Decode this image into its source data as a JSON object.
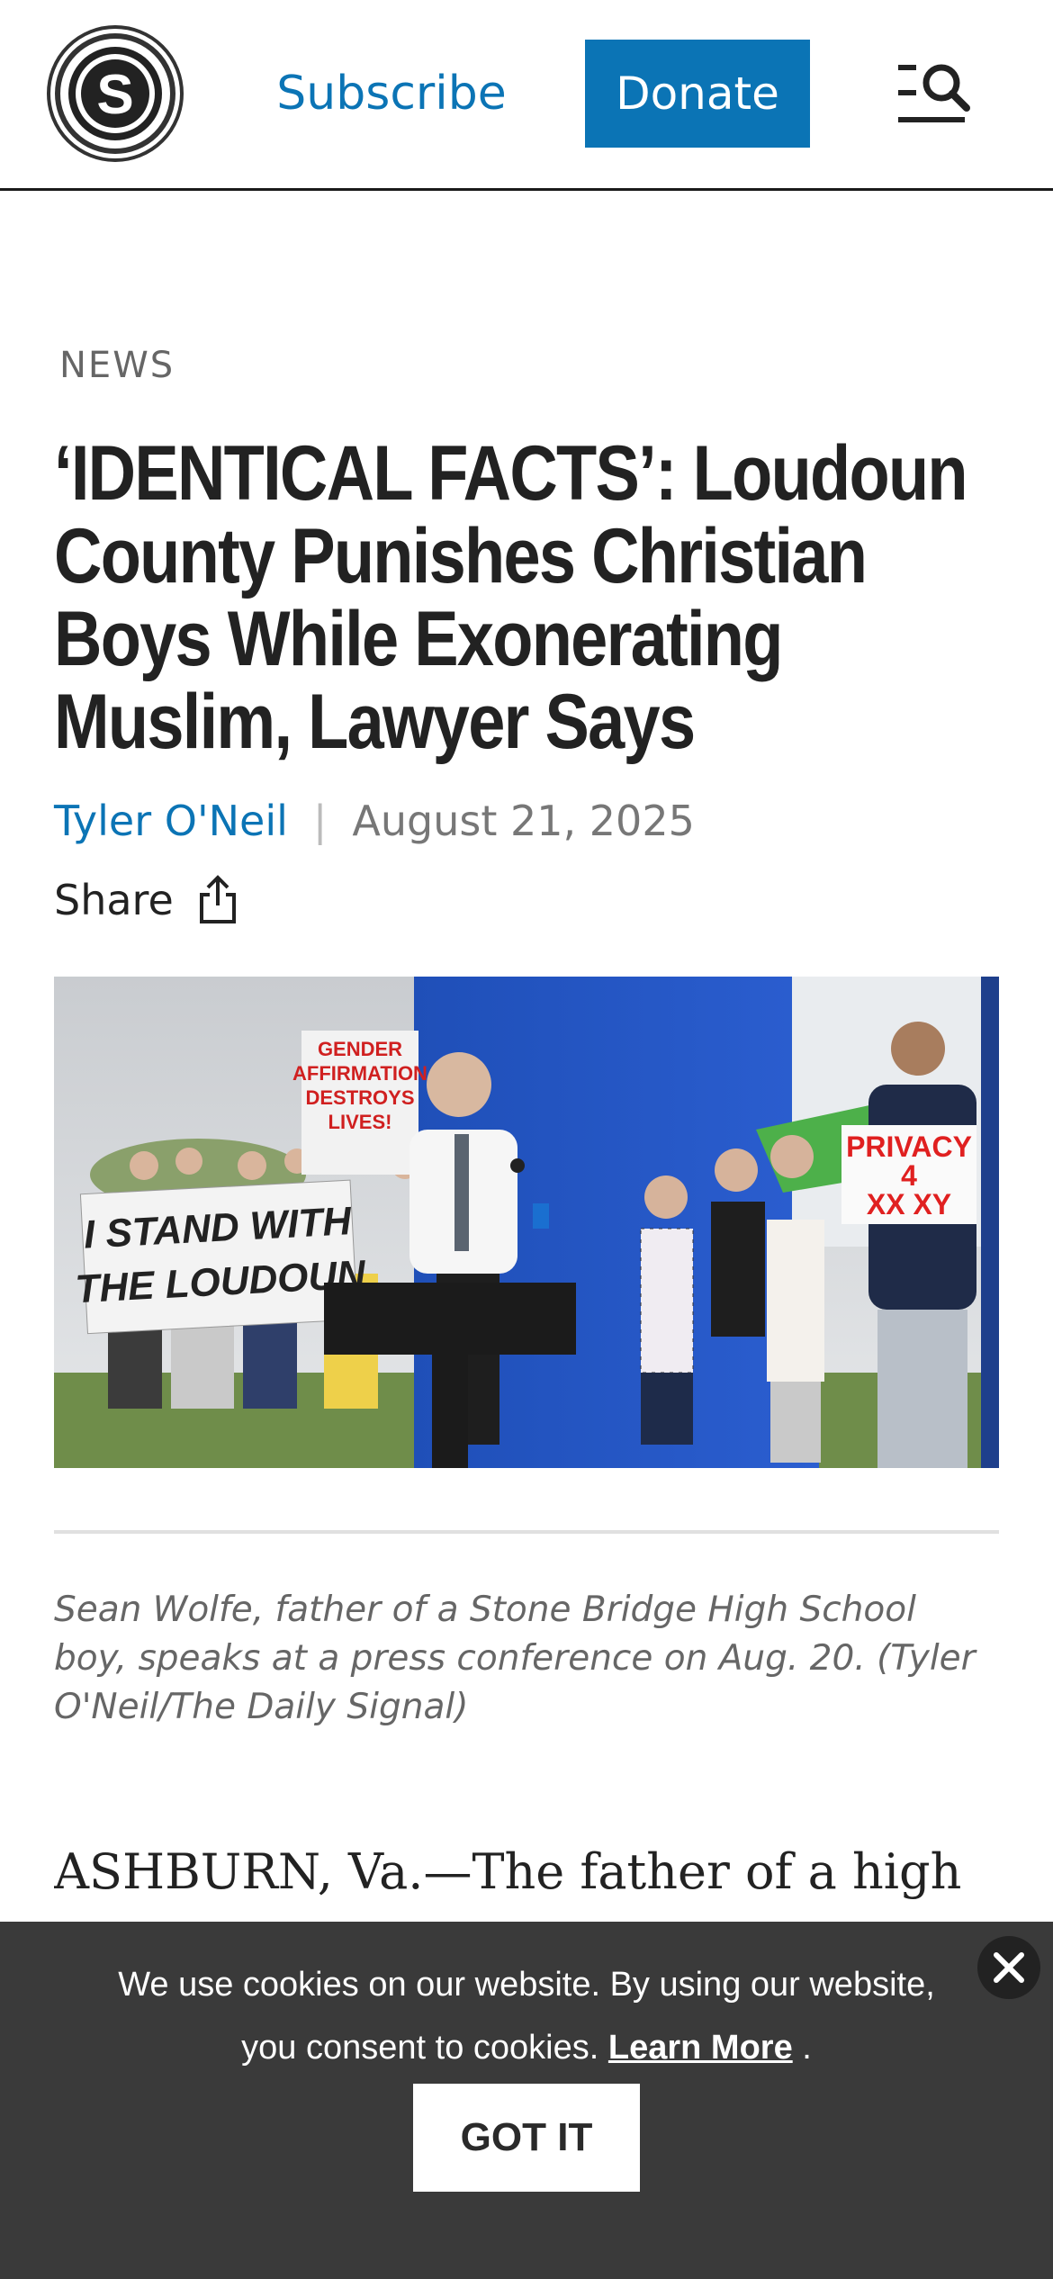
{
  "header": {
    "logo_letter": "S",
    "subscribe_label": "Subscribe",
    "donate_label": "Donate",
    "menu_icon": "menu-search-icon"
  },
  "article": {
    "category": "NEWS",
    "headline": "‘IDENTICAL FACTS’: Loudoun County Punishes Christian Boys While Exonerating Muslim, Lawyer Says",
    "author": "Tyler O'Neil",
    "byline_separator": "|",
    "date": "August 21, 2025",
    "share_label": "Share",
    "photo": {
      "sign_left": [
        "I STAND WITH",
        "THE LOUDOUN"
      ],
      "sign_top": [
        "GENDER",
        "AFFIRMATION",
        "DESTROYS",
        "LIVES!"
      ],
      "sign_right": [
        "PRIVACY",
        "4",
        "XX XY"
      ]
    },
    "caption": "Sean Wolfe, father of a Stone Bridge High School boy, speaks at a press conference on Aug. 20. (Tyler O'Neil/The Daily Signal)",
    "lede": "ASHBURN, Va.—The father of a high"
  },
  "cookie_banner": {
    "text": "We use cookies on our website. By using our website, you consent to cookies.",
    "learn_more_label": "Learn More",
    "trailing": ".",
    "got_it_label": "GOT IT"
  },
  "colors": {
    "accent": "#0b74b5",
    "banner_bg": "#3a3a3a",
    "header_rule": "#1a1a1a"
  }
}
